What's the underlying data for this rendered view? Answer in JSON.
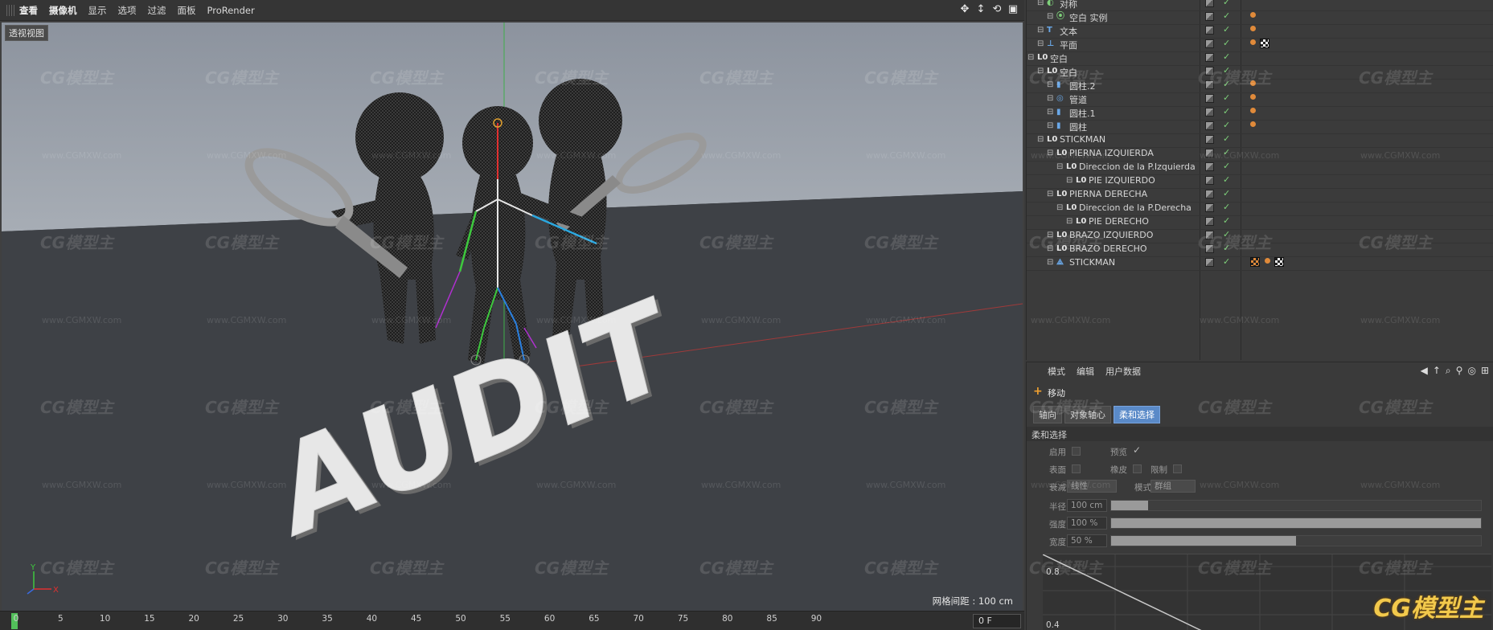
{
  "viewport": {
    "menu": [
      "查看",
      "摄像机",
      "显示",
      "选项",
      "过滤",
      "面板",
      "ProRender"
    ],
    "label": "透视视图",
    "grid_spacing": "网格间距 : 100 cm",
    "scene_text": "AUDIT",
    "axis_y": "Y",
    "axis_x": "X"
  },
  "timeline": {
    "ticks": [
      "0",
      "5",
      "10",
      "15",
      "20",
      "25",
      "30",
      "35",
      "40",
      "45",
      "50",
      "55",
      "60",
      "65",
      "70",
      "75",
      "80",
      "85",
      "90"
    ],
    "frame": "0 F"
  },
  "objects": [
    {
      "name": "对称",
      "indent": 1,
      "icon": "symmetry-icon",
      "tags": []
    },
    {
      "name": "空白 实例",
      "indent": 2,
      "icon": "instance-icon",
      "tags": [
        "orange"
      ]
    },
    {
      "name": "文本",
      "indent": 1,
      "icon": "text-icon",
      "tags": [
        "orange"
      ]
    },
    {
      "name": "平面",
      "indent": 1,
      "icon": "plane-icon",
      "tags": [
        "orange",
        "checker"
      ]
    },
    {
      "name": "空白",
      "indent": 0,
      "icon": "null-icon",
      "tags": []
    },
    {
      "name": "空白",
      "indent": 1,
      "icon": "null-icon",
      "tags": []
    },
    {
      "name": "圆柱.2",
      "indent": 2,
      "icon": "cylinder-icon",
      "tags": [
        "orange"
      ]
    },
    {
      "name": "管道",
      "indent": 2,
      "icon": "tube-icon",
      "tags": [
        "orange"
      ]
    },
    {
      "name": "圆柱.1",
      "indent": 2,
      "icon": "cylinder-icon",
      "tags": [
        "orange"
      ]
    },
    {
      "name": "圆柱",
      "indent": 2,
      "icon": "cylinder-icon",
      "tags": [
        "orange"
      ]
    },
    {
      "name": "STICKMAN",
      "indent": 1,
      "icon": "null-icon",
      "tags": []
    },
    {
      "name": "PIERNA IZQUIERDA",
      "indent": 2,
      "icon": "null-icon",
      "tags": []
    },
    {
      "name": "Direccion de la P.Izquierda",
      "indent": 3,
      "icon": "null-icon",
      "tags": []
    },
    {
      "name": "PIE IZQUIERDO",
      "indent": 4,
      "icon": "null-icon",
      "tags": []
    },
    {
      "name": "PIERNA DERECHA",
      "indent": 2,
      "icon": "null-icon",
      "tags": []
    },
    {
      "name": "Direccion de la P.Derecha",
      "indent": 3,
      "icon": "null-icon",
      "tags": []
    },
    {
      "name": "PIE DERECHO",
      "indent": 4,
      "icon": "null-icon",
      "tags": []
    },
    {
      "name": "BRAZO IZQUIERDO",
      "indent": 2,
      "icon": "null-icon",
      "tags": []
    },
    {
      "name": "BRAZO DERECHO",
      "indent": 2,
      "icon": "null-icon",
      "tags": []
    },
    {
      "name": "STICKMAN",
      "indent": 2,
      "icon": "polygon-icon",
      "tags": [
        "weight",
        "orange",
        "checker"
      ]
    }
  ],
  "attributes": {
    "menu": [
      "模式",
      "编辑",
      "用户数据"
    ],
    "title": "移动",
    "tabs": [
      "轴向",
      "对象轴心",
      "柔和选择"
    ],
    "active_tab": "柔和选择",
    "section": "柔和选择",
    "fields": {
      "enable": "启用",
      "preview": "预览",
      "surface": "表面",
      "rubber": "橡皮",
      "restrict": "限制",
      "falloff": "衰减",
      "falloff_value": "线性",
      "mode": "模式",
      "mode_value": "群组",
      "radius": "半径",
      "radius_value": "100 cm",
      "strength": "强度",
      "strength_value": "100 %",
      "width": "宽度",
      "width_value": "50 %",
      "curve_top": "0.8",
      "curve_bottom": "0.4"
    },
    "sliders": {
      "radius": 0.1,
      "strength": 1.0,
      "width": 0.5
    }
  },
  "watermark": {
    "logo": "CG模型主",
    "url": "www.CGMXW.com"
  }
}
